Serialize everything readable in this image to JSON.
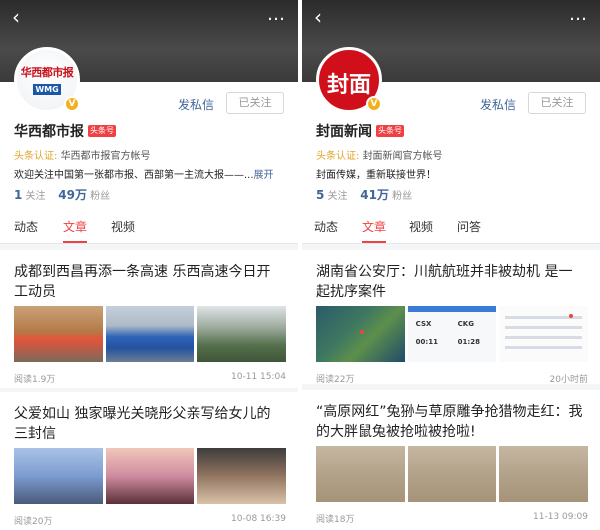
{
  "left": {
    "header": {
      "back_icon": "back-arrow-icon",
      "more_icon": "more-dots-icon"
    },
    "profile": {
      "avatar_logo_top": "华西都市报",
      "avatar_logo_box": "WMG",
      "verified_badge": "V",
      "message_label": "发私信",
      "follow_label": "已关注",
      "name": "华西都市报",
      "tag": "头条号",
      "cert_label": "头条认证:",
      "cert_text": "华西都市报官方帐号",
      "bio": "欢迎关注中国第一张都市报、西部第一主流大报——...",
      "expand": "展开",
      "following_num": "1",
      "following_label": "关注",
      "fans_num": "49万",
      "fans_label": "粉丝"
    },
    "tabs": [
      "动态",
      "文章",
      "视频"
    ],
    "active_tab": 1,
    "articles": [
      {
        "title": "成都到西昌再添一条高速 乐西高速今日开工动员",
        "reads": "阅读1.9万",
        "time": "10-11 15:04"
      },
      {
        "title": "父爱如山 独家曝光关晓彤父亲写给女儿的三封信",
        "reads": "阅读20万",
        "time": "10-08 16:39"
      }
    ]
  },
  "right": {
    "header": {
      "back_icon": "back-arrow-icon",
      "more_icon": "more-dots-icon"
    },
    "profile": {
      "avatar_logo": "封面",
      "verified_badge": "V",
      "message_label": "发私信",
      "follow_label": "已关注",
      "name": "封面新闻",
      "tag": "头条号",
      "cert_label": "头条认证:",
      "cert_text": "封面新闻官方帐号",
      "bio": "封面传媒，重新联接世界！",
      "following_num": "5",
      "following_label": "关注",
      "fans_num": "41万",
      "fans_label": "粉丝"
    },
    "tabs": [
      "动态",
      "文章",
      "视频",
      "问答"
    ],
    "active_tab": 1,
    "articles": [
      {
        "title": "湖南省公安厅：川航航班并非被劫机 是一起扰序案件",
        "reads": "阅读22万",
        "time": "20小时前",
        "ticket_codes": [
          "CSX",
          "CKG",
          "00:11",
          "01:28"
        ]
      },
      {
        "title": "“高原网红”兔狲与草原雕争抢猎物走红：我的大胖鼠兔被抢啦被抢啦!",
        "reads": "阅读18万",
        "time": "11-13 09:09"
      }
    ]
  }
}
